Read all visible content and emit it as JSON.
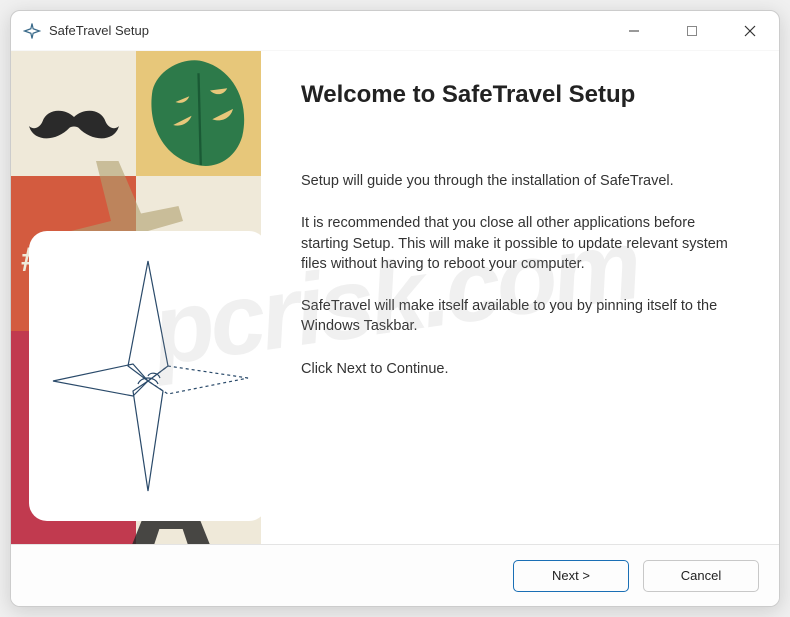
{
  "window": {
    "title": "SafeTravel Setup"
  },
  "main": {
    "heading": "Welcome to SafeTravel Setup",
    "para1": "Setup will guide you through the installation of SafeTravel.",
    "para2": "It is recommended that you close all other applications before starting Setup.  This will make it possible to update relevant system files without having to reboot your computer.",
    "para3": "SafeTravel will make itself available to you by pinning itself to the Windows Taskbar.",
    "para4": "Click Next to Continue."
  },
  "buttons": {
    "next": "Next >",
    "cancel": "Cancel"
  },
  "watermark": "pcrisk.com"
}
